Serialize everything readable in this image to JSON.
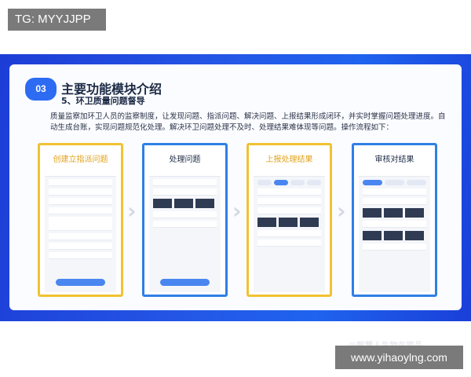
{
  "overlay_top": "TG: MYYJJPP",
  "overlay_bottom": "www.yihaoylng.com",
  "slide": {
    "badge": "03",
    "title": "主要功能模块介绍",
    "subtitle": "5、环卫质量问题督导",
    "description": "质量监察加环卫人员的监察制度，让发现问题、指派问题、解决问题、上报结果形成闭环，并实时掌握问题处理进度。自动生成台账，实现问题规范化处理。解决环卫问题处理不及时、处理结果难体现等问题。操作流程如下：",
    "steps": [
      {
        "title": "创建立指派问题"
      },
      {
        "title": "处理问题"
      },
      {
        "title": "上报处理结果"
      },
      {
        "title": "审核对结果"
      }
    ],
    "corner_watermark": "@智慧人生物在闻品"
  },
  "colors": {
    "band": "#2457e6",
    "badge": "#2d6cf2",
    "frame_yellow": "#f1c232",
    "frame_blue": "#2f7fe6"
  },
  "icons": [
    "chevron-right-icon"
  ]
}
